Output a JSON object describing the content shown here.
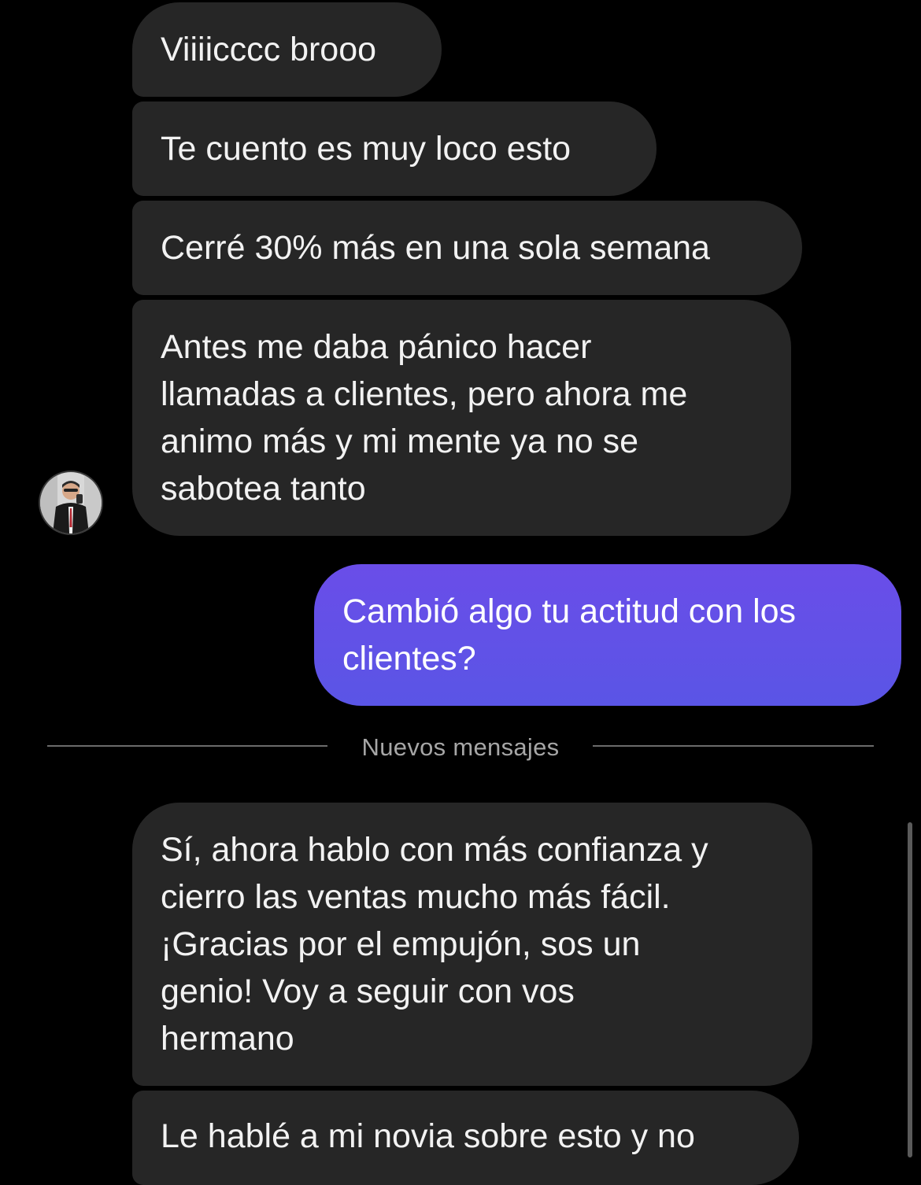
{
  "thread": {
    "messages_before": [
      {
        "text": "Viiiicccc brooo",
        "from": "contact"
      },
      {
        "text": "Te cuento es muy loco esto",
        "from": "contact"
      },
      {
        "text": "Cerré 30% más en una sola semana",
        "from": "contact"
      },
      {
        "text": "Antes me daba pánico hacer\nllamadas a clientes, pero ahora me\nanimo más y mi mente ya no se\nsabotea tanto",
        "from": "contact"
      },
      {
        "text": "Cambió algo tu actitud con los\nclientes?",
        "from": "me"
      }
    ],
    "new_messages_divider": "Nuevos mensajes",
    "messages_after": [
      {
        "text": "Sí, ahora hablo con más confianza y\ncierro las ventas mucho más fácil.\n¡Gracias por el empujón, sos un\ngenio! Voy a seguir con vos\nhermano",
        "from": "contact"
      },
      {
        "text": "Le hablé a mi novia sobre esto y no",
        "from": "contact"
      }
    ]
  },
  "contact": {
    "avatar_icon": "user-avatar-photo"
  },
  "colors": {
    "background": "#000000",
    "incoming_bubble": "#262626",
    "outgoing_bubble": "#5f52e7",
    "divider_text": "#a6a6a6"
  }
}
